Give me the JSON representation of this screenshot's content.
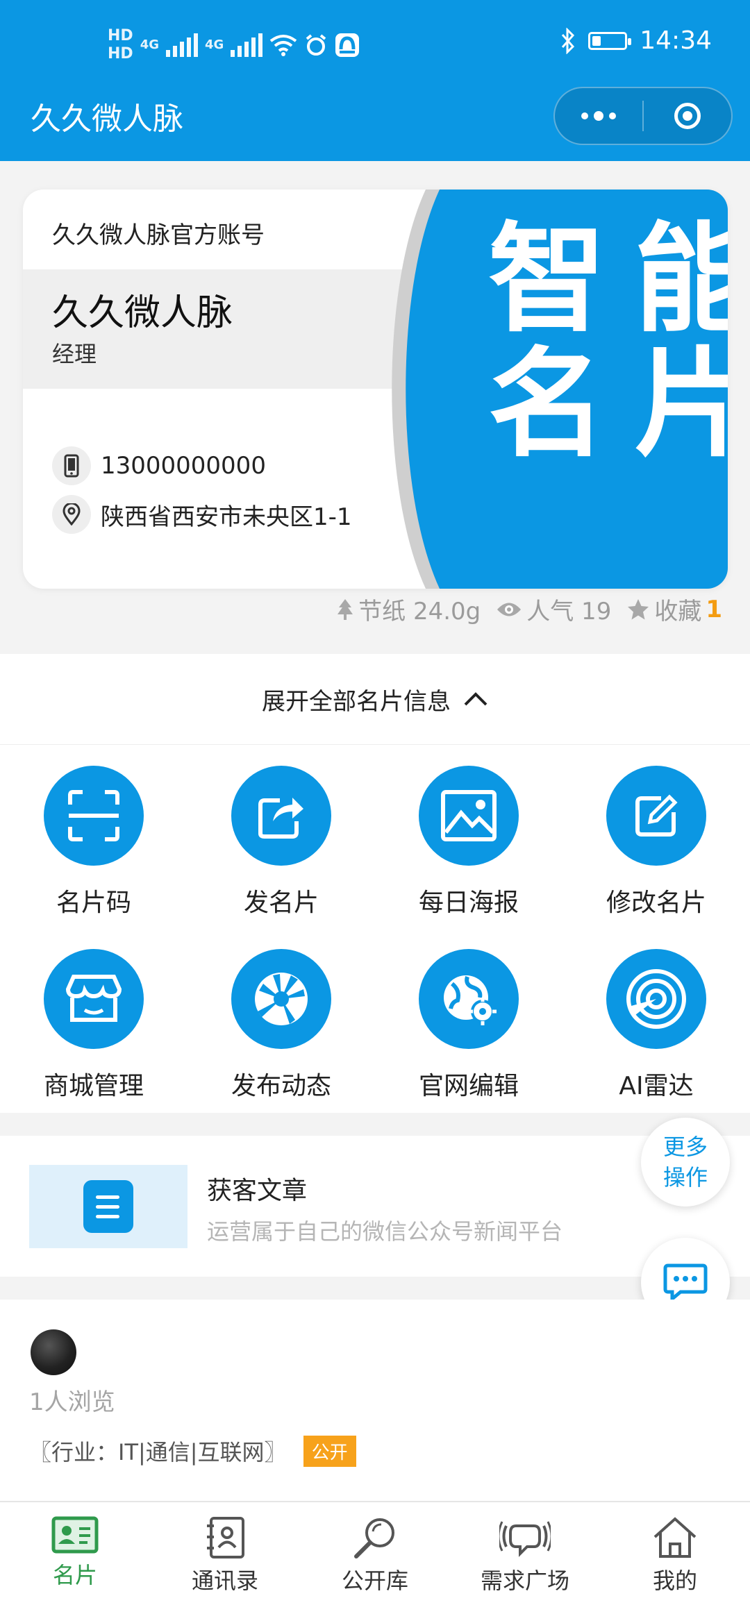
{
  "status_bar": {
    "time": "14:34",
    "hd1": "HD",
    "hd2": "HD",
    "net1": "4G",
    "net2": "4G"
  },
  "header": {
    "title": "久久微人脉",
    "menu_icon": "more-dots-icon",
    "close_icon": "target-circle-icon"
  },
  "card": {
    "company": "久久微人脉官方账号",
    "name": "久久微人脉",
    "position": "经理",
    "phone": "13000000000",
    "address": "陕西省西安市未央区1-1",
    "art_line1": "智能",
    "art_line2": "名片",
    "accent": "#0b97e3"
  },
  "stats": {
    "paper": "节纸 24.0g",
    "popularity": "人气 19",
    "favorites_label": "收藏",
    "favorites_count": "1"
  },
  "expand": {
    "label": "展开全部名片信息"
  },
  "grid": {
    "items": [
      {
        "label": "名片码",
        "icon": "scan-code-icon"
      },
      {
        "label": "发名片",
        "icon": "share-icon"
      },
      {
        "label": "每日海报",
        "icon": "image-icon"
      },
      {
        "label": "修改名片",
        "icon": "edit-icon"
      },
      {
        "label": "商城管理",
        "icon": "store-icon"
      },
      {
        "label": "发布动态",
        "icon": "aperture-icon"
      },
      {
        "label": "官网编辑",
        "icon": "globe-gear-icon"
      },
      {
        "label": "AI雷达",
        "icon": "radar-icon"
      }
    ]
  },
  "article": {
    "title": "获客文章",
    "subtitle": "运营属于自己的微信公众号新闻平台"
  },
  "floating": {
    "more_line1": "更多",
    "more_line2": "操作",
    "chat_icon": "chat-bubble-icon"
  },
  "visitors": {
    "count_text": "1人浏览",
    "industry": "〖行业：IT|通信|互联网〗",
    "badge": "公开"
  },
  "tabbar": {
    "items": [
      {
        "label": "名片",
        "icon": "card-icon",
        "active": true
      },
      {
        "label": "通讯录",
        "icon": "contacts-icon",
        "active": false
      },
      {
        "label": "公开库",
        "icon": "search-icon",
        "active": false
      },
      {
        "label": "需求广场",
        "icon": "broadcast-icon",
        "active": false
      },
      {
        "label": "我的",
        "icon": "home-icon",
        "active": false
      }
    ],
    "active_color": "#2f9a4c"
  }
}
